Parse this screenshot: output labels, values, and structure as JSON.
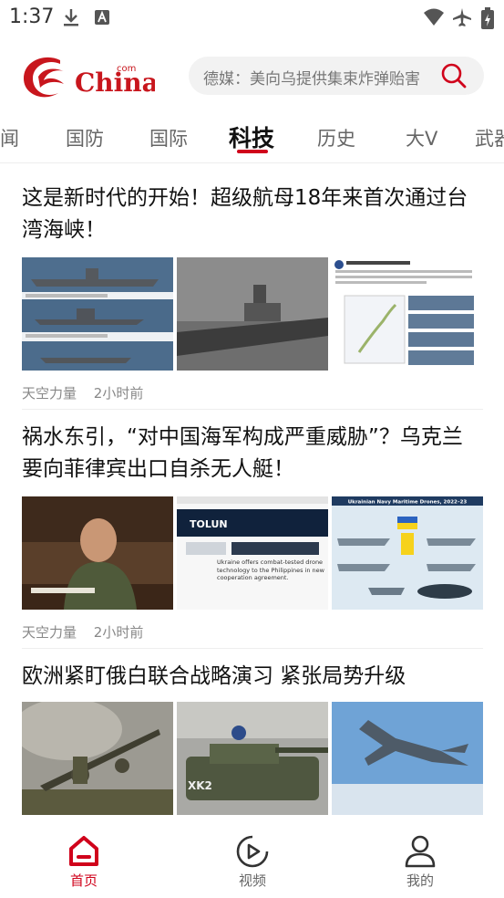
{
  "status_bar": {
    "time": "1:37"
  },
  "header": {
    "logo_text": "China",
    "logo_sup": "com",
    "search_placeholder": "德媒：美向乌提供集束炸弹贻害"
  },
  "tabs": [
    "闻",
    "国防",
    "国际",
    "科技",
    "历史",
    "大V",
    "武器"
  ],
  "active_tab": "科技",
  "articles": [
    {
      "title": "这是新时代的开始！超级航母18年来首次通过台湾海峡！",
      "source": "天空力量",
      "time": "2小时前"
    },
    {
      "title": "祸水东引，“对中国海军构成严重威胁”？乌克兰要向菲律宾出口自杀无人艇！",
      "source": "天空力量",
      "time": "2小时前"
    },
    {
      "title": "欧洲紧盯俄白联合战略演习 紧张局势升级"
    }
  ],
  "thumb_text": {
    "a2_t3_title": "Ukrainian Navy Maritime Drones, 2022–23",
    "a2_t2_brand": "TOLUN",
    "a2_t2_headline": "Ukraine offers combat-tested drone technology to the Philippines in new cooperation agreement.",
    "a3_t2_label": "XK2"
  },
  "bottom_nav": [
    {
      "label": "首页",
      "active": true
    },
    {
      "label": "视频",
      "active": false
    },
    {
      "label": "我的",
      "active": false
    }
  ],
  "colors": {
    "accent": "#d0021b"
  }
}
